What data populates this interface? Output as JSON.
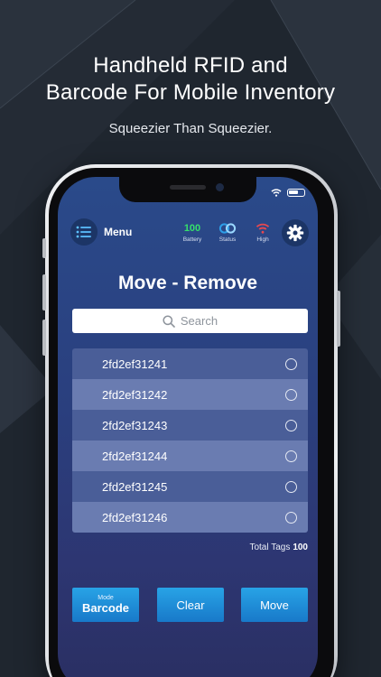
{
  "promo": {
    "headline_line1": "Handheld RFID and",
    "headline_line2": "Barcode For Mobile Inventory",
    "tagline": "Squeezier Than Squeezier."
  },
  "colors": {
    "background": "#1f262f",
    "accent_button": "#1e8fd8",
    "battery_green": "#35e06b",
    "signal_red": "#e8484f",
    "status_blue": "#2e9fe8"
  },
  "app": {
    "menu_label": "Menu",
    "battery": {
      "value": "100",
      "label": "Battery"
    },
    "status": {
      "label": "Status",
      "icon": "link-rings-icon"
    },
    "signal": {
      "label": "High",
      "icon": "wifi-signal-icon"
    },
    "settings_icon": "gear-icon",
    "title": "Move - Remove",
    "search": {
      "placeholder": "Search"
    },
    "tags": [
      {
        "id": "2fd2ef31241",
        "selected": false
      },
      {
        "id": "2fd2ef31242",
        "selected": false
      },
      {
        "id": "2fd2ef31243",
        "selected": false
      },
      {
        "id": "2fd2ef31244",
        "selected": false
      },
      {
        "id": "2fd2ef31245",
        "selected": false
      },
      {
        "id": "2fd2ef31246",
        "selected": false
      }
    ],
    "total_label": "Total Tags",
    "total_value": "100",
    "buttons": {
      "mode_small": "Mode",
      "mode_main": "Barcode",
      "clear": "Clear",
      "move": "Move"
    }
  }
}
